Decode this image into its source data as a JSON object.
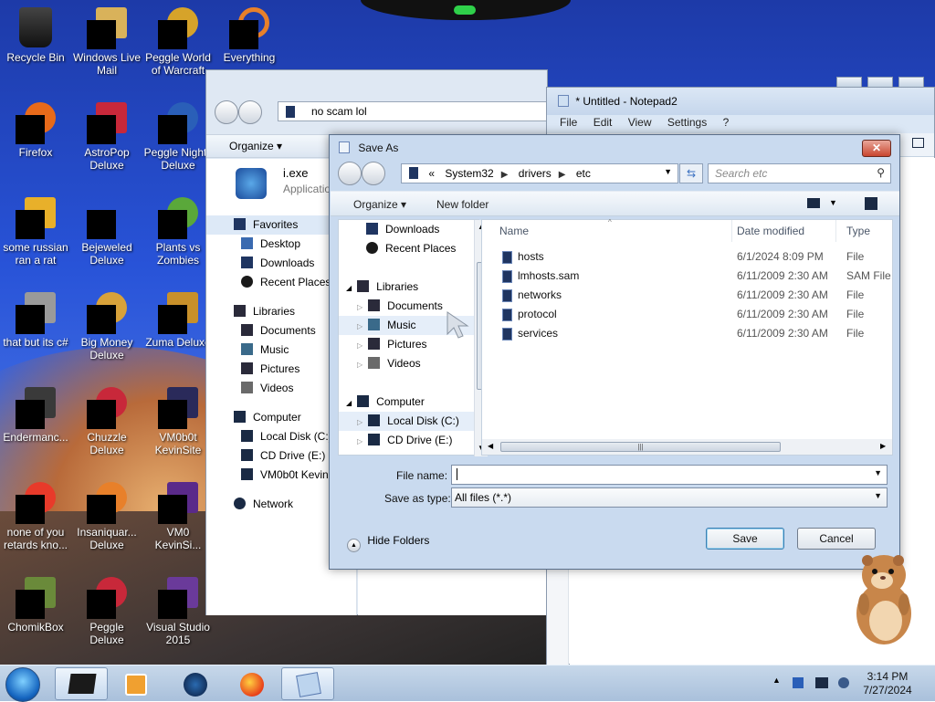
{
  "desktop": {
    "icons": [
      {
        "label": "Recycle Bin",
        "color": "#111111"
      },
      {
        "label": "Windows Live Mail",
        "color": "#d9b25a"
      },
      {
        "label": "Peggle World of Warcraft",
        "color": "#d6a32a"
      },
      {
        "label": "Everything",
        "color": "#e8802a"
      },
      {
        "label": "Firefox",
        "color": "#e86a1a"
      },
      {
        "label": "AstroPop Deluxe",
        "color": "#c8283a"
      },
      {
        "label": "Peggle Nights Deluxe",
        "color": "#2a5fb8"
      },
      {
        "label": "some russian ran a rat",
        "color": "#e8b02a"
      },
      {
        "label": "Bejeweled Deluxe",
        "color": "#8a8a8a"
      },
      {
        "label": "Plants vs Zombies",
        "color": "#5aa83a"
      },
      {
        "label": "that but its c#",
        "color": "#9a9a9a"
      },
      {
        "label": "Big Money Deluxe",
        "color": "#d8a23a"
      },
      {
        "label": "Zuma Deluxe",
        "color": "#c8902a"
      },
      {
        "label": "Endermanc...",
        "color": "#3a3a3a"
      },
      {
        "label": "Chuzzle Deluxe",
        "color": "#c8283a"
      },
      {
        "label": "VM0b0t KevinSite",
        "color": "#2a2a5a"
      },
      {
        "label": "none of you retards kno...",
        "color": "#e83a2a"
      },
      {
        "label": "Insaniquar... Deluxe",
        "color": "#e8802a"
      },
      {
        "label": "VM0 KevinSi...",
        "color": "#5a2a8a"
      },
      {
        "label": "ChomikBox",
        "color": "#6a8a3a"
      },
      {
        "label": "Peggle Deluxe",
        "color": "#c8283a"
      },
      {
        "label": "Visual Studio 2015",
        "color": "#6a3a9a"
      }
    ]
  },
  "explorer": {
    "address": "no scam lol",
    "organize": "Organize",
    "file_name": "i.exe",
    "file_type": "Applicatio",
    "nav": {
      "favorites": "Favorites",
      "desktop": "Desktop",
      "downloads": "Downloads",
      "recent_places": "Recent Places",
      "libraries": "Libraries",
      "documents": "Documents",
      "music": "Music",
      "pictures": "Pictures",
      "videos": "Videos",
      "computer": "Computer",
      "local_disk": "Local Disk (C:)",
      "cd_drive": "CD Drive (E:)",
      "vm_share": "VM0b0t KevinS",
      "network": "Network"
    }
  },
  "notepad": {
    "title": "* Untitled - Notepad2",
    "menu": [
      "File",
      "Edit",
      "View",
      "Settings",
      "?"
    ]
  },
  "dialog": {
    "title": "Save As",
    "close": "✕",
    "breadcrumb": {
      "prefix": "«",
      "segments": [
        "System32",
        "drivers",
        "etc"
      ]
    },
    "search_placeholder": "Search etc",
    "organize": "Organize",
    "new_folder": "New folder",
    "tree": {
      "downloads": "Downloads",
      "recent_places": "Recent Places",
      "libraries": "Libraries",
      "documents": "Documents",
      "music": "Music",
      "pictures": "Pictures",
      "videos": "Videos",
      "computer": "Computer",
      "local_disk": "Local Disk (C:)",
      "cd_drive": "CD Drive (E:)"
    },
    "columns": {
      "name": "Name",
      "date": "Date modified",
      "type": "Type"
    },
    "files": [
      {
        "name": "hosts",
        "date": "6/1/2024 8:09 PM",
        "type": "File"
      },
      {
        "name": "lmhosts.sam",
        "date": "6/11/2009 2:30 AM",
        "type": "SAM File"
      },
      {
        "name": "networks",
        "date": "6/11/2009 2:30 AM",
        "type": "File"
      },
      {
        "name": "protocol",
        "date": "6/11/2009 2:30 AM",
        "type": "File"
      },
      {
        "name": "services",
        "date": "6/11/2009 2:30 AM",
        "type": "File"
      }
    ],
    "file_name_label": "File name:",
    "file_name_value": "",
    "save_type_label": "Save as type:",
    "save_type_value": "All files (*.*)",
    "hide_folders": "Hide Folders",
    "save": "Save",
    "cancel": "Cancel"
  },
  "taskbar": {
    "time": "3:14 PM",
    "date": "7/27/2024"
  }
}
